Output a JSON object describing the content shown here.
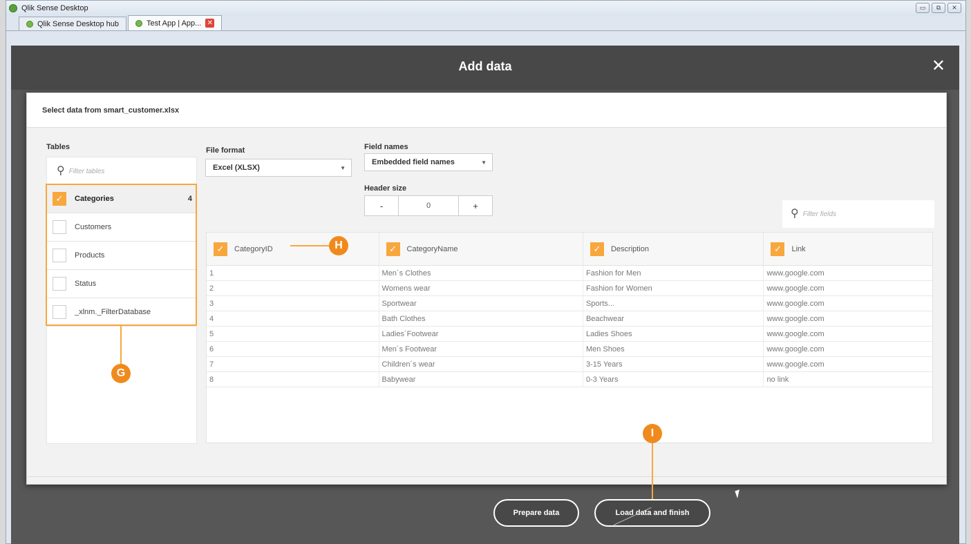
{
  "window": {
    "title": "Qlik Sense Desktop",
    "controls": [
      "▭",
      "⧉",
      "✕"
    ]
  },
  "tabs": [
    {
      "label": "Qlik Sense Desktop hub"
    },
    {
      "label": "Test App | App...",
      "close_icon": "✕"
    }
  ],
  "dialog": {
    "title": "Add data",
    "close_glyph": "✕",
    "subtitle": "Select data from smart_customer.xlsx"
  },
  "tables": {
    "label": "Tables",
    "filter_placeholder": "Filter tables",
    "items": [
      {
        "name": "Categories",
        "checked": true,
        "count": "4"
      },
      {
        "name": "Customers",
        "checked": false
      },
      {
        "name": "Products",
        "checked": false
      },
      {
        "name": "Status",
        "checked": false
      },
      {
        "name": "_xlnm._FilterDatabase",
        "checked": false
      }
    ]
  },
  "controls": {
    "file_format_label": "File format",
    "file_format_value": "Excel (XLSX)",
    "field_names_label": "Field names",
    "field_names_value": "Embedded field names",
    "header_size_label": "Header size",
    "header_minus": "-",
    "header_value": "0",
    "header_plus": "+",
    "filter_fields_placeholder": "Filter fields"
  },
  "grid": {
    "columns": [
      "CategoryID",
      "CategoryName",
      "Description",
      "Link"
    ],
    "rows": [
      [
        "1",
        "Men´s Clothes",
        "Fashion for Men",
        "www.google.com"
      ],
      [
        "2",
        "Womens wear",
        "Fashion for Women",
        "www.google.com"
      ],
      [
        "3",
        "Sportwear",
        "Sports...",
        "www.google.com"
      ],
      [
        "4",
        "Bath Clothes",
        "Beachwear",
        "www.google.com"
      ],
      [
        "5",
        "Ladies´Footwear",
        "Ladies Shoes",
        "www.google.com"
      ],
      [
        "6",
        "Men´s Footwear",
        "Men Shoes",
        "www.google.com"
      ],
      [
        "7",
        "Children´s wear",
        "3-15 Years",
        "www.google.com"
      ],
      [
        "8",
        "Babywear",
        "0-3 Years",
        "no link"
      ]
    ]
  },
  "buttons": {
    "prepare": "Prepare data",
    "load": "Load data and finish"
  },
  "callouts": {
    "g": "G",
    "h": "H",
    "i": "I"
  },
  "colors": {
    "accent": "#f8a73d",
    "callout": "#f08a1c",
    "overlay": "#575757"
  }
}
